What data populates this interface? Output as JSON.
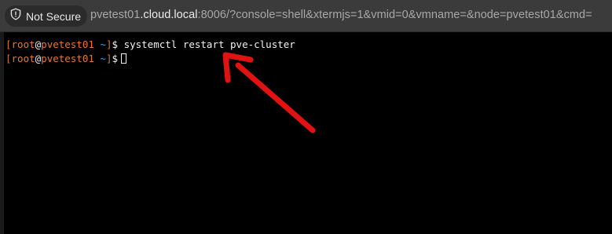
{
  "address_bar": {
    "security_label": "Not Secure",
    "security_icon": "shield-warning-icon",
    "url_host_prefix": "pvetest01",
    "url_host_domain": ".cloud.local",
    "url_rest": ":8006/?console=shell&xtermjs=1&vmid=0&vmname=&node=pvetest01&cmd="
  },
  "terminal": {
    "lines": [
      {
        "bracket_open": "[",
        "user": "root",
        "at": "@",
        "host": "pvetest01",
        "path": " ~",
        "bracket_close": "]",
        "symbol": "$ ",
        "command": "systemctl restart pve-cluster"
      },
      {
        "bracket_open": "[",
        "user": "root",
        "at": "@",
        "host": "pvetest01",
        "path": " ~",
        "bracket_close": "]",
        "symbol": "$",
        "command": ""
      }
    ]
  },
  "annotation": {
    "arrow_color": "#e01212",
    "arrow_icon": "arrow-annotation-icon"
  }
}
